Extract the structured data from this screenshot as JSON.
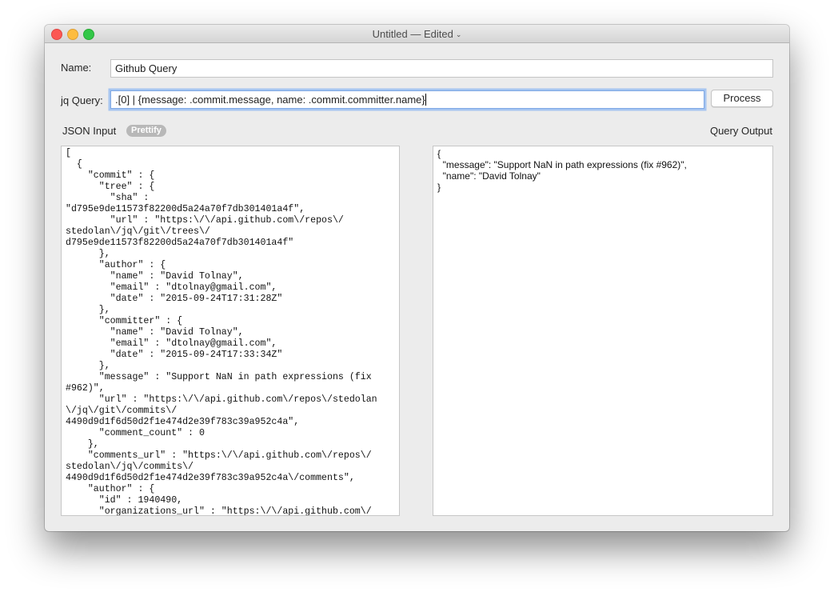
{
  "window": {
    "title": "Untitled",
    "separator": "—",
    "status": "Edited",
    "status_chevron": "⌄"
  },
  "form": {
    "name_label": "Name:",
    "name_value": "Github Query",
    "query_label": "jq Query:",
    "query_value": ".[0] | {message: .commit.message, name: .commit.committer.name}",
    "process_button": "Process"
  },
  "json_input": {
    "label": "JSON Input",
    "prettify_button": "Prettify",
    "lines": [
      "[",
      "  {",
      "    \"commit\" : {",
      "      \"tree\" : {",
      "        \"sha\" :",
      "\"d795e9de11573f82200d5a24a70f7db301401a4f\",",
      "        \"url\" : \"https:\\/\\/api.github.com\\/repos\\/",
      "stedolan\\/jq\\/git\\/trees\\/",
      "d795e9de11573f82200d5a24a70f7db301401a4f\"",
      "      },",
      "      \"author\" : {",
      "        \"name\" : \"David Tolnay\",",
      "        \"email\" : \"dtolnay@gmail.com\",",
      "        \"date\" : \"2015-09-24T17:31:28Z\"",
      "      },",
      "      \"committer\" : {",
      "        \"name\" : \"David Tolnay\",",
      "        \"email\" : \"dtolnay@gmail.com\",",
      "        \"date\" : \"2015-09-24T17:33:34Z\"",
      "      },",
      "      \"message\" : \"Support NaN in path expressions (fix",
      "#962)\",",
      "      \"url\" : \"https:\\/\\/api.github.com\\/repos\\/stedolan",
      "\\/jq\\/git\\/commits\\/",
      "4490d9d1f6d50d2f1e474d2e39f783c39a952c4a\",",
      "      \"comment_count\" : 0",
      "    },",
      "    \"comments_url\" : \"https:\\/\\/api.github.com\\/repos\\/",
      "stedolan\\/jq\\/commits\\/",
      "4490d9d1f6d50d2f1e474d2e39f783c39a952c4a\\/comments\",",
      "    \"author\" : {",
      "      \"id\" : 1940490,",
      "      \"organizations_url\" : \"https:\\/\\/api.github.com\\/"
    ]
  },
  "query_output": {
    "label": "Query Output",
    "lines": [
      "{",
      "  \"message\": \"Support NaN in path expressions (fix #962)\",",
      "  \"name\": \"David Tolnay\"",
      "}"
    ]
  }
}
